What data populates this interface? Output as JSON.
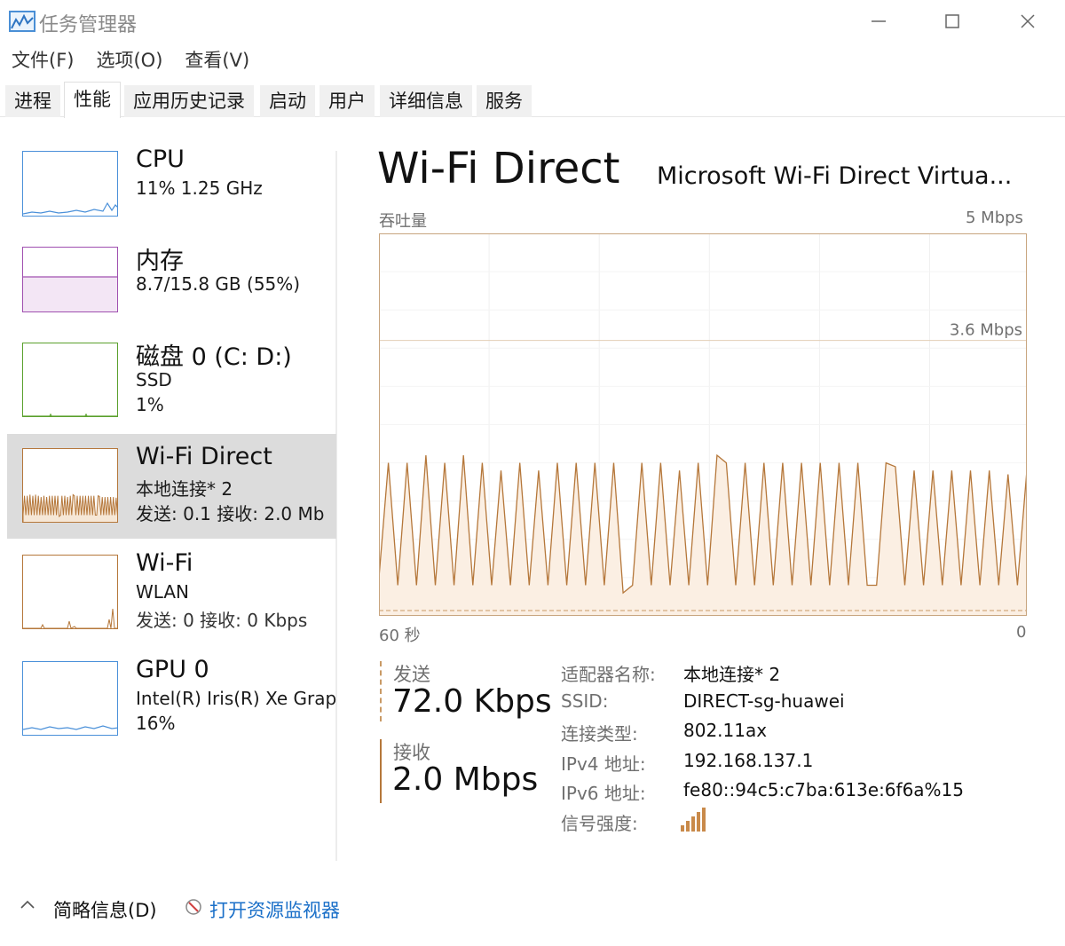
{
  "window": {
    "title": "任务管理器"
  },
  "menu": [
    "文件(F)",
    "选项(O)",
    "查看(V)"
  ],
  "tabs": [
    {
      "label": "进程",
      "active": false
    },
    {
      "label": "性能",
      "active": true
    },
    {
      "label": "应用历史记录",
      "active": false
    },
    {
      "label": "启动",
      "active": false
    },
    {
      "label": "用户",
      "active": false
    },
    {
      "label": "详细信息",
      "active": false
    },
    {
      "label": "服务",
      "active": false
    }
  ],
  "sidebar": {
    "items": [
      {
        "title": "CPU",
        "lines": [
          "11% 1.25 GHz"
        ],
        "color": "#4a90d9",
        "selected": false
      },
      {
        "title": "内存",
        "lines": [
          "8.7/15.8 GB (55%)"
        ],
        "color": "#a050b0",
        "selected": false
      },
      {
        "title": "磁盘 0 (C: D:)",
        "lines": [
          "SSD",
          "1%"
        ],
        "color": "#5aa02c",
        "selected": false
      },
      {
        "title": "Wi-Fi Direct",
        "lines": [
          "本地连接* 2",
          "发送: 0.1 接收: 2.0 Mb"
        ],
        "color": "#b5773a",
        "selected": true
      },
      {
        "title": "Wi-Fi",
        "lines": [
          "WLAN",
          "发送: 0 接收: 0 Kbps"
        ],
        "color": "#b5773a",
        "selected": false
      },
      {
        "title": "GPU 0",
        "lines": [
          "Intel(R) Iris(R) Xe Grap",
          "16%"
        ],
        "color": "#4a90d9",
        "selected": false
      }
    ]
  },
  "main": {
    "title": "Wi-Fi Direct",
    "subtitle": "Microsoft Wi-Fi Direct Virtua...",
    "throughput_label": "吞吐量",
    "max_label": "5 Mbps",
    "mid_label": "3.6 Mbps",
    "time_left_label": "60 秒",
    "time_right_label": "0",
    "send_label": "发送",
    "send_value": "72.0 Kbps",
    "recv_label": "接收",
    "recv_value": "2.0 Mbps",
    "properties": [
      {
        "key": "适配器名称:",
        "value": "本地连接* 2"
      },
      {
        "key": "SSID:",
        "value": "DIRECT-sg-huawei"
      },
      {
        "key": "连接类型:",
        "value": "802.11ax"
      },
      {
        "key": "IPv4 地址:",
        "value": "192.168.137.1"
      },
      {
        "key": "IPv6 地址:",
        "value": "fe80::94c5:c7ba:613e:6f6a%15"
      },
      {
        "key": "信号强度:",
        "value": ""
      }
    ],
    "signal_bars": 5,
    "accent_color": "#b5773a"
  },
  "footer": {
    "fewer_details": "简略信息(D)",
    "open_monitor": "打开资源监视器"
  },
  "chart_data": {
    "type": "line",
    "title": "",
    "xlabel": "",
    "ylabel": "吞吐量",
    "xlim": [
      60,
      0
    ],
    "ylim": [
      0,
      5
    ],
    "x_tick_labels": [
      "60 秒",
      "0"
    ],
    "y_labels": [
      "5 Mbps",
      "3.6 Mbps"
    ],
    "grid": true,
    "series": [
      {
        "name": "接收",
        "values": [
          0.5,
          2.0,
          0.4,
          2.0,
          0.4,
          2.1,
          0.4,
          2.0,
          0.4,
          2.1,
          0.4,
          2.0,
          0.4,
          1.9,
          0.4,
          2.0,
          0.4,
          1.9,
          0.4,
          2.0,
          0.4,
          2.0,
          0.4,
          2.0,
          0.4,
          2.0,
          0.3,
          0.4,
          2.0,
          0.4,
          2.0,
          0.4,
          1.9,
          0.4,
          2.0,
          0.4,
          2.1,
          2.0,
          0.4,
          2.0,
          0.4,
          2.0,
          0.4,
          2.0,
          0.4,
          2.0,
          0.4,
          2.0,
          0.4,
          2.0,
          0.4,
          2.0,
          0.4,
          0.4,
          2.0,
          1.95,
          0.4,
          1.9,
          0.4,
          1.9,
          0.4,
          1.9,
          0.4,
          1.9,
          0.4,
          1.9,
          0.4,
          1.85,
          0.4,
          1.9
        ]
      },
      {
        "name": "发送",
        "values": [
          0.07,
          0.07,
          0.07,
          0.07,
          0.07,
          0.07,
          0.07,
          0.07,
          0.07,
          0.07,
          0.07,
          0.07,
          0.07,
          0.07,
          0.07,
          0.07,
          0.07,
          0.07,
          0.07,
          0.07,
          0.07,
          0.07,
          0.07,
          0.07,
          0.07,
          0.07,
          0.07,
          0.07,
          0.07,
          0.07,
          0.07,
          0.07,
          0.07,
          0.07,
          0.07,
          0.07,
          0.07,
          0.07,
          0.07,
          0.07,
          0.07,
          0.07,
          0.07,
          0.07,
          0.07,
          0.07,
          0.07,
          0.07,
          0.07,
          0.07,
          0.07,
          0.07,
          0.07,
          0.07,
          0.07,
          0.07,
          0.07,
          0.07,
          0.07,
          0.07,
          0.07,
          0.07,
          0.07,
          0.07,
          0.07,
          0.07,
          0.07,
          0.07,
          0.07,
          0.07
        ]
      }
    ]
  }
}
